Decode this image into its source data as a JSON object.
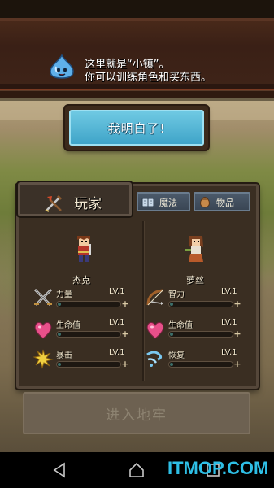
{
  "banner": {
    "line1": "这里就是“小镇”。",
    "line2": "你可以训练角色和买东西。",
    "icon": "blue-slime-icon"
  },
  "ok_button": {
    "label": "我明白了!"
  },
  "tabs": {
    "players": "玩家",
    "magic": "魔法",
    "items": "物品"
  },
  "characters": [
    {
      "name": "杰克",
      "stats": [
        {
          "name": "力量",
          "level": "LV.1",
          "icon": "crossed-swords-icon"
        },
        {
          "name": "生命值",
          "level": "LV.1",
          "icon": "heart-icon"
        },
        {
          "name": "暴击",
          "level": "LV.1",
          "icon": "burst-icon"
        }
      ]
    },
    {
      "name": "萝丝",
      "stats": [
        {
          "name": "智力",
          "level": "LV.1",
          "icon": "bow-icon"
        },
        {
          "name": "生命值",
          "level": "LV.1",
          "icon": "heart-icon"
        },
        {
          "name": "恢复",
          "level": "LV.1",
          "icon": "wind-icon"
        }
      ]
    }
  ],
  "enter_button": {
    "label": "进入地牢"
  },
  "watermark": "ITMOP.COM",
  "colors": {
    "ok_button": "#4fb2d4",
    "banner": "#3a2016",
    "panel": "#3a2e22",
    "watermark": "#2ebfe6"
  }
}
